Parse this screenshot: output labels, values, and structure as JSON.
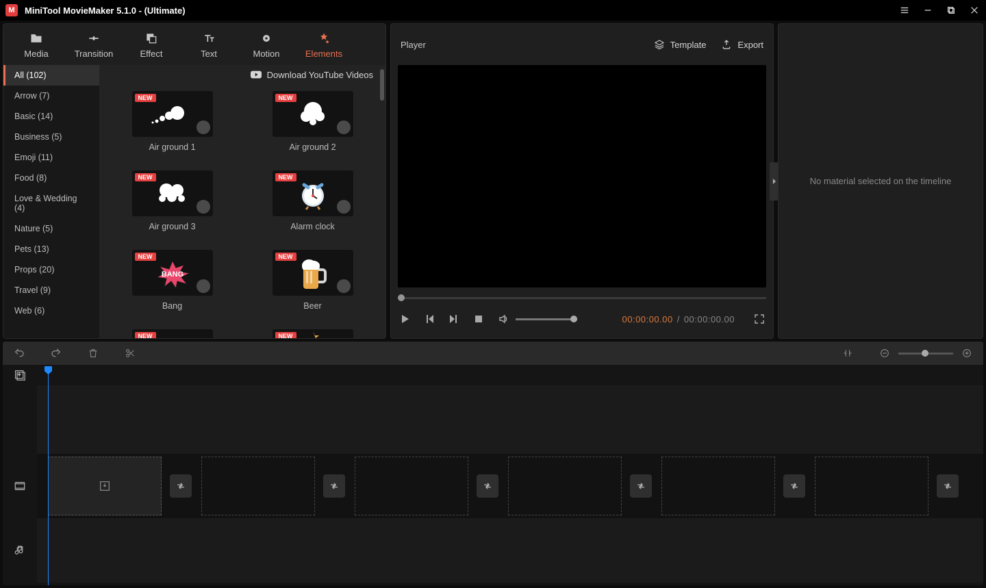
{
  "titlebar": {
    "title": "MiniTool MovieMaker 5.1.0 - (Ultimate)"
  },
  "tabs": [
    {
      "label": "Media"
    },
    {
      "label": "Transition"
    },
    {
      "label": "Effect"
    },
    {
      "label": "Text"
    },
    {
      "label": "Motion"
    },
    {
      "label": "Elements"
    }
  ],
  "categories": [
    {
      "label": "All (102)",
      "active": true
    },
    {
      "label": "Arrow (7)"
    },
    {
      "label": "Basic (14)"
    },
    {
      "label": "Business (5)"
    },
    {
      "label": "Emoji (11)"
    },
    {
      "label": "Food (8)"
    },
    {
      "label": "Love & Wedding (4)"
    },
    {
      "label": "Nature (5)"
    },
    {
      "label": "Pets (13)"
    },
    {
      "label": "Props (20)"
    },
    {
      "label": "Travel (9)"
    },
    {
      "label": "Web (6)"
    }
  ],
  "gridTop": {
    "download_youtube": "Download YouTube Videos"
  },
  "elements": [
    {
      "label": "Air ground 1",
      "new": "NEW"
    },
    {
      "label": "Air ground 2",
      "new": "NEW"
    },
    {
      "label": "Air ground 3",
      "new": "NEW"
    },
    {
      "label": "Alarm clock",
      "new": "NEW"
    },
    {
      "label": "Bang",
      "new": "NEW"
    },
    {
      "label": "Beer",
      "new": "NEW"
    }
  ],
  "partialRow": {
    "new": "NEW"
  },
  "player": {
    "title": "Player",
    "template": "Template",
    "export": "Export",
    "time_current": "00:00:00.00",
    "time_sep": "/",
    "time_total": "00:00:00.00"
  },
  "inspector": {
    "empty": "No material selected on the timeline"
  }
}
